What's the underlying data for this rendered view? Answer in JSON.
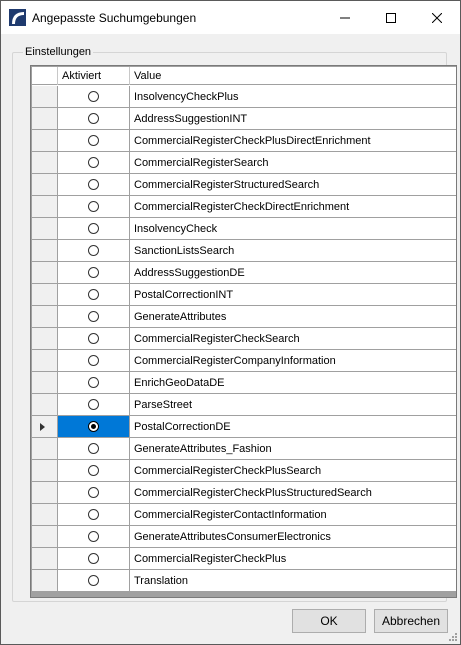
{
  "window": {
    "title": "Angepasste Suchumgebungen"
  },
  "group": {
    "label": "Einstellungen"
  },
  "grid": {
    "columns": [
      "",
      "Aktiviert",
      "Value"
    ],
    "rows": [
      {
        "value": "InsolvencyCheckPlus",
        "checked": false
      },
      {
        "value": "AddressSuggestionINT",
        "checked": false
      },
      {
        "value": "CommercialRegisterCheckPlusDirectEnrichment",
        "checked": false
      },
      {
        "value": "CommercialRegisterSearch",
        "checked": false
      },
      {
        "value": "CommercialRegisterStructuredSearch",
        "checked": false
      },
      {
        "value": "CommercialRegisterCheckDirectEnrichment",
        "checked": false
      },
      {
        "value": "InsolvencyCheck",
        "checked": false
      },
      {
        "value": "SanctionListsSearch",
        "checked": false
      },
      {
        "value": "AddressSuggestionDE",
        "checked": false
      },
      {
        "value": "PostalCorrectionINT",
        "checked": false
      },
      {
        "value": "GenerateAttributes",
        "checked": false
      },
      {
        "value": "CommercialRegisterCheckSearch",
        "checked": false
      },
      {
        "value": "CommercialRegisterCompanyInformation",
        "checked": false
      },
      {
        "value": "EnrichGeoDataDE",
        "checked": false
      },
      {
        "value": "ParseStreet",
        "checked": false
      },
      {
        "value": "PostalCorrectionDE",
        "checked": true,
        "current": true
      },
      {
        "value": "GenerateAttributes_Fashion",
        "checked": false
      },
      {
        "value": "CommercialRegisterCheckPlusSearch",
        "checked": false
      },
      {
        "value": "CommercialRegisterCheckPlusStructuredSearch",
        "checked": false
      },
      {
        "value": "CommercialRegisterContactInformation",
        "checked": false
      },
      {
        "value": "GenerateAttributesConsumerElectronics",
        "checked": false
      },
      {
        "value": "CommercialRegisterCheckPlus",
        "checked": false
      },
      {
        "value": "Translation",
        "checked": false
      }
    ]
  },
  "buttons": {
    "ok": "OK",
    "cancel": "Abbrechen"
  },
  "colors": {
    "selection": "#0078d7",
    "app_icon": "#1f3a6e"
  }
}
